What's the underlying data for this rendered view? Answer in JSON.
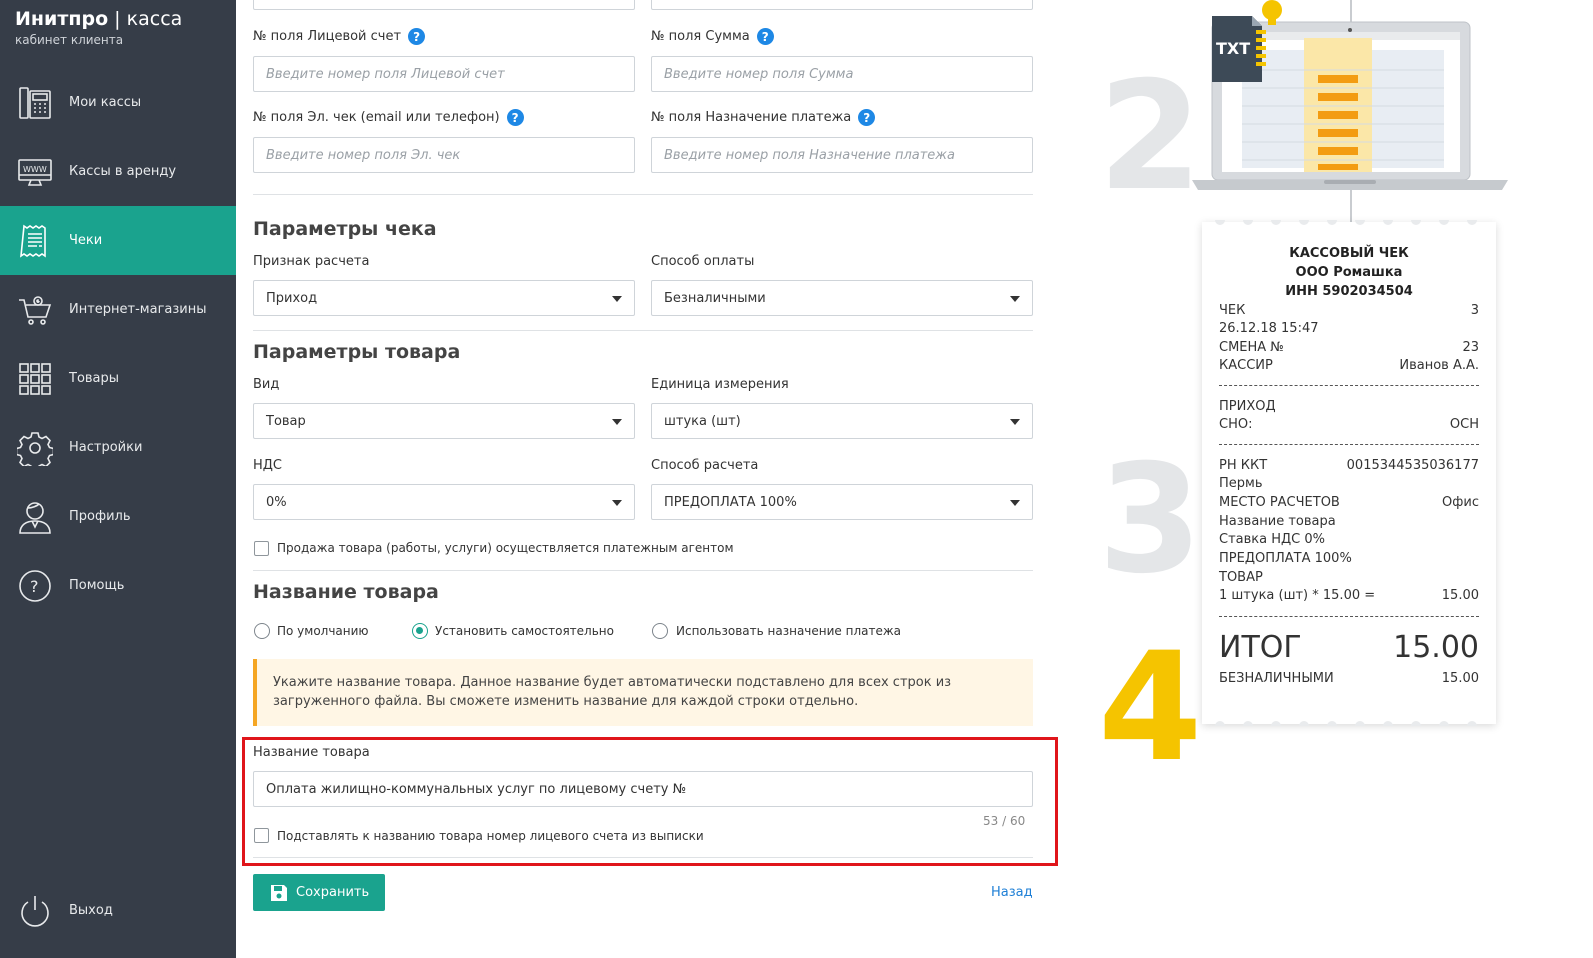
{
  "sidebar": {
    "logo_brand": "Инитпро",
    "logo_divider": " | ",
    "logo_product": "касса",
    "logo_subtitle": "кабинет клиента",
    "items": [
      {
        "label": "Мои кассы",
        "icon": "register-icon"
      },
      {
        "label": "Кассы в аренду",
        "icon": "www-monitor-icon"
      },
      {
        "label": "Чеки",
        "icon": "receipt-icon",
        "active": true
      },
      {
        "label": "Интернет-магазины",
        "icon": "shopping-cart-icon"
      },
      {
        "label": "Товары",
        "icon": "grid-icon"
      },
      {
        "label": "Настройки",
        "icon": "gear-icon"
      },
      {
        "label": "Профиль",
        "icon": "user-icon"
      },
      {
        "label": "Помощь",
        "icon": "question-icon"
      }
    ],
    "logout_label": "Выход"
  },
  "fields": {
    "account_label": "№ поля Лицевой счет",
    "account_placeholder": "Введите номер поля Лицевой счет",
    "sum_label": "№ поля Сумма",
    "sum_placeholder": "Введите номер поля Сумма",
    "echeck_label": "№ поля Эл. чек (email или телефон)",
    "echeck_placeholder": "Введите номер поля Эл. чек",
    "purpose_label": "№ поля Назначение платежа",
    "purpose_placeholder": "Введите номер поля Назначение платежа",
    "help_glyph": "?"
  },
  "check_params": {
    "title": "Параметры чека",
    "calc_sign_label": "Признак расчета",
    "calc_sign_value": "Приход",
    "payment_method_label": "Способ оплаты",
    "payment_method_value": "Безналичными"
  },
  "product_params": {
    "title": "Параметры товара",
    "kind_label": "Вид",
    "kind_value": "Товар",
    "unit_label": "Единица измерения",
    "unit_value": "штука (шт)",
    "vat_label": "НДС",
    "vat_value": "0%",
    "calc_method_label": "Способ расчета",
    "calc_method_value": "ПРЕДОПЛАТА 100%",
    "agent_checkbox_label": "Продажа товара (работы, услуги) осуществляется платежным агентом"
  },
  "product_name": {
    "title": "Название товара",
    "radio_default": "По умолчанию",
    "radio_custom": "Установить самостоятельно",
    "radio_purpose": "Использовать назначение платежа",
    "note_line1": "Укажите название товара. Данное название будет автоматически подставлено для всех строк из",
    "note_line2": "загруженного файла. Вы сможете изменить название для каждой строки отдельно.",
    "field_label": "Название товара",
    "field_value": "Оплата жилищно-коммунальных услуг по лицевому счету №",
    "counter": "53 / 60",
    "append_checkbox_label": "Подставлять к названию товара номер лицевого счета из выписки"
  },
  "actions": {
    "save_label": "Сохранить",
    "back_label": "Назад"
  },
  "illustration": {
    "step2": "2",
    "step3": "3",
    "step4": "4",
    "file_badge": "TXT",
    "colors": {
      "step_gray": "#e4e6e8",
      "step_yellow": "#f5c400",
      "accent": "#1aa38e",
      "highlight": "#e0151b"
    }
  },
  "receipt": {
    "title1": "КАССОВЫЙ ЧЕК",
    "title2": "ООО Ромашка",
    "title3": "ИНН 5902034504",
    "check_label": "ЧЕК",
    "check_value": "3",
    "datetime": "26.12.18 15:47",
    "shift_label": "СМЕНА №",
    "shift_value": "23",
    "cashier_label": "КАССИР",
    "cashier_value": "Иванов А.А.",
    "income": "ПРИХОД",
    "sno_label": "СНО:",
    "sno_value": "ОСН",
    "rn_label": "РН ККТ",
    "rn_value": "0015344535036177",
    "city": "Пермь",
    "place_label": "МЕСТО РАСЧЕТОВ",
    "place_value": "Офис",
    "product_name": "Название товара",
    "vat_rate": "Ставка НДС 0%",
    "prepay": "ПРЕДОПЛАТА 100%",
    "item_type": "ТОВАР",
    "qty_line": "1 штука (шт) * 15.00 =",
    "qty_total": "15.00",
    "total_label": "ИТОГ",
    "total_value": "15.00",
    "cashless_label": "БЕЗНАЛИЧНЫМИ",
    "cashless_value": "15.00"
  }
}
